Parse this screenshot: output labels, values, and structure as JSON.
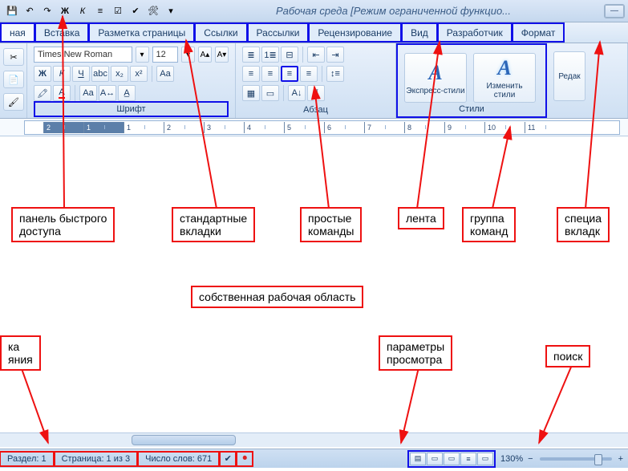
{
  "title": "Рабочая среда [Режим ограниченной функцио...",
  "qat_icons": [
    "save",
    "undo",
    "redo",
    "bold",
    "italic",
    "bullets",
    "checkbox",
    "spellcheck",
    "tools",
    "dropdown"
  ],
  "tabs": [
    "ная",
    "Вставка",
    "Разметка страницы",
    "Ссылки",
    "Рассылки",
    "Рецензирование",
    "Вид",
    "Разработчик",
    "Формат"
  ],
  "font": {
    "name": "Times New Roman",
    "size": "12"
  },
  "group_labels": {
    "font": "Шрифт",
    "para": "Абзац",
    "styles": "Стили"
  },
  "styles": {
    "quick": "Экспресс-стили",
    "change": "Изменить\nстили",
    "edit": "Редак"
  },
  "ruler_marks": [
    "2",
    "1",
    "",
    "1",
    "2",
    "3",
    "4",
    "5",
    "6",
    "7",
    "8",
    "9",
    "10",
    "11"
  ],
  "callouts": {
    "qat": "панель быстрого\nдоступа",
    "stdtabs": "стандартные\nвкладки",
    "simplecmd": "простые\nкоманды",
    "ribbon": "лента",
    "group": "группа\nкоманд",
    "special": "специа\nвкладк",
    "workarea": "собственная рабочая область",
    "state": "ка\nяния",
    "viewparams": "параметры\nпросмотра",
    "search": "поиск"
  },
  "status": {
    "section": "Раздел: 1",
    "page": "Страница: 1 из 3",
    "words": "Число слов: 671",
    "zoom": "130%"
  }
}
